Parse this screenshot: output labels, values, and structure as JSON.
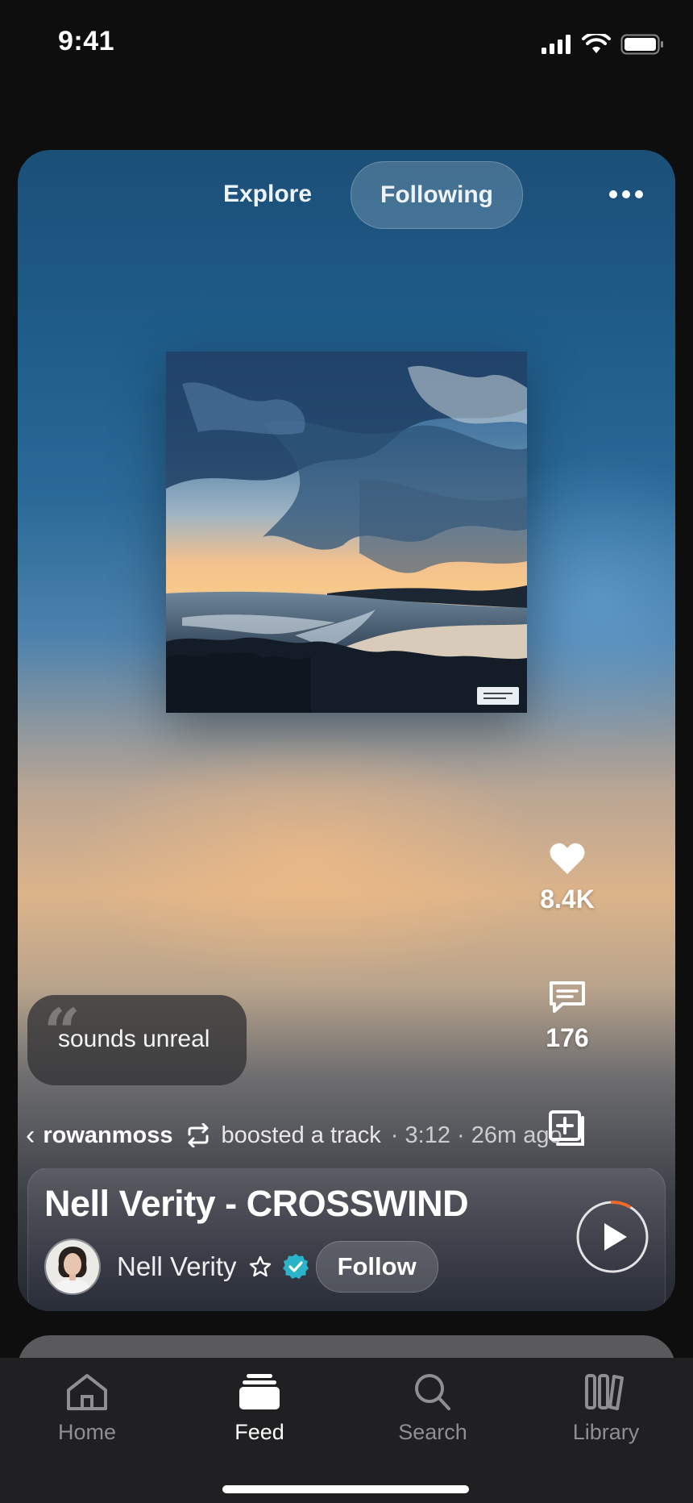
{
  "status_bar": {
    "time": "9:41"
  },
  "header": {
    "tabs": [
      {
        "label": "Explore"
      },
      {
        "label": "Following"
      }
    ],
    "active_tab": "Following"
  },
  "actions": {
    "like_count": "8.4K",
    "comment_count": "176"
  },
  "comment": {
    "text": "sounds unreal"
  },
  "boost": {
    "username": "rowanmoss",
    "action_text": "boosted a track",
    "meta": "· 3:12 · 26m ago"
  },
  "track": {
    "title": "Nell Verity - CROSSWIND",
    "artist": "Nell Verity",
    "follow_label": "Follow",
    "play_progress": 0.08
  },
  "tabbar": {
    "items": [
      {
        "label": "Home",
        "icon": "home-icon"
      },
      {
        "label": "Feed",
        "icon": "feed-icon"
      },
      {
        "label": "Search",
        "icon": "search-icon"
      },
      {
        "label": "Library",
        "icon": "library-icon"
      }
    ],
    "active": "Feed"
  },
  "colors": {
    "accent": "#f06a2b",
    "verified": "#2ab3c9",
    "background": "#0e0e0f",
    "tabbar": "#202022"
  }
}
